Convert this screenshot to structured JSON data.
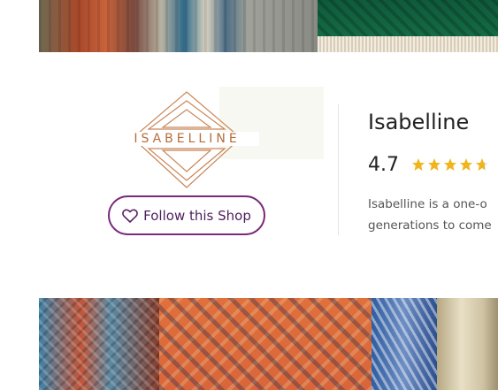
{
  "logo": {
    "text": "ISABELLINE",
    "color": "#b86b3a"
  },
  "follow_button": {
    "label": "Follow this Shop",
    "icon": "heart-outline-icon",
    "color": "#7a2a7a"
  },
  "shop": {
    "name": "Isabelline",
    "rating": "4.7",
    "rating_value": 4.7,
    "stars_max": 5,
    "star_color": "#f0b41e",
    "description_lines": [
      "Isabelline is a one-o",
      "generations to come"
    ]
  },
  "images": {
    "top_hero": "rugs-photo",
    "bottom_hero": "rugs-photo"
  }
}
